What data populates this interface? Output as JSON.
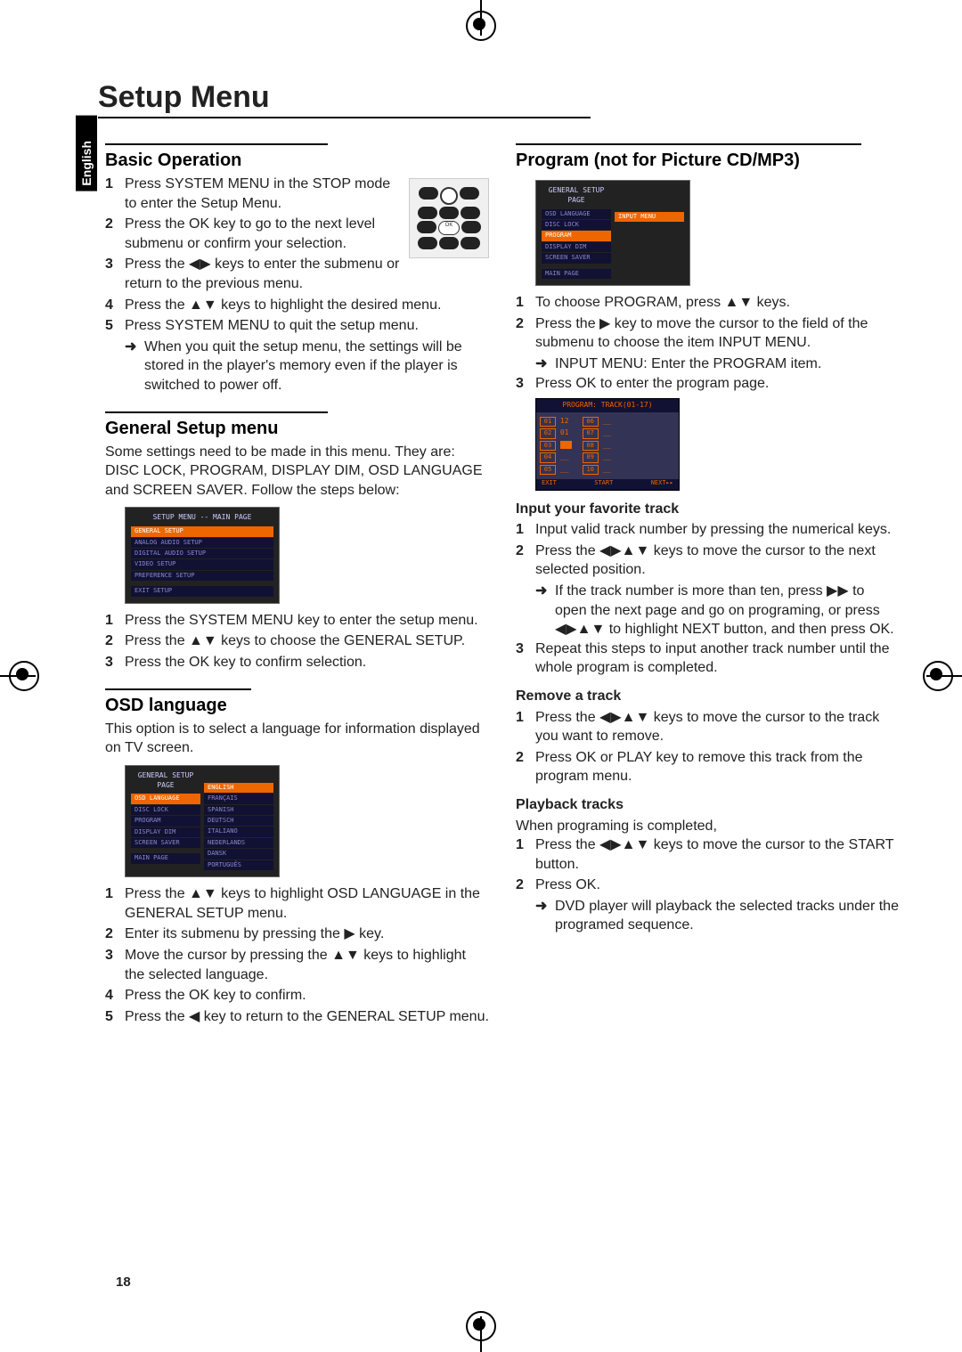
{
  "language_tab": "English",
  "page_title": "Setup Menu",
  "page_number": "18",
  "left": {
    "basic_operation": {
      "heading": "Basic Operation",
      "steps": [
        "Press SYSTEM MENU in the STOP mode to enter the Setup Menu.",
        "Press the OK key to go to the next level submenu or confirm your selection.",
        "Press the ◀▶ keys to enter the submenu or return to the previous menu.",
        "Press the ▲▼ keys to highlight the desired menu.",
        "Press SYSTEM MENU to quit the setup menu."
      ],
      "note": "When you quit the setup menu, the settings will be stored in the player's memory even if the player is switched to power off."
    },
    "general_setup": {
      "heading": "General Setup menu",
      "intro": "Some settings need to be made in this menu. They are: DISC LOCK, PROGRAM, DISPLAY DIM, OSD LANGUAGE and SCREEN SAVER. Follow the steps below:",
      "shot_title": "SETUP MENU -- MAIN PAGE",
      "shot_items": [
        "GENERAL SETUP",
        "ANALOG AUDIO SETUP",
        "DIGITAL AUDIO SETUP",
        "VIDEO SETUP",
        "PREFERENCE SETUP",
        "EXIT SETUP"
      ],
      "steps": [
        "Press the SYSTEM MENU key to enter the setup menu.",
        "Press the ▲▼ keys to choose the GENERAL SETUP.",
        "Press the OK key to confirm selection."
      ]
    },
    "osd_language": {
      "heading": "OSD language",
      "intro": "This option is to select a language for information displayed on TV screen.",
      "shot_title": "GENERAL SETUP PAGE",
      "shot_left": [
        "OSD LANGUAGE",
        "DISC LOCK",
        "PROGRAM",
        "DISPLAY DIM",
        "SCREEN SAVER",
        "MAIN PAGE"
      ],
      "shot_right": [
        "ENGLISH",
        "FRANÇAIS",
        "SPANISH",
        "DEUTSCH",
        "ITALIANO",
        "NEDERLANDS",
        "DANSK",
        "PORTUGUÊS"
      ],
      "steps": [
        "Press the ▲▼ keys to highlight OSD LANGUAGE in the GENERAL SETUP menu.",
        "Enter its submenu by pressing the ▶ key.",
        "Move the cursor by pressing the ▲▼ keys to highlight the selected language.",
        "Press the OK key to confirm.",
        "Press the ◀ key to return to the GENERAL SETUP menu."
      ]
    }
  },
  "right": {
    "program": {
      "heading": "Program (not for Picture CD/MP3)",
      "shot_title": "GENERAL SETUP PAGE",
      "shot_left": [
        "OSD LANGUAGE",
        "DISC LOCK",
        "PROGRAM",
        "DISPLAY DIM",
        "SCREEN SAVER",
        "MAIN PAGE"
      ],
      "shot_right_hl": "INPUT MENU",
      "steps": [
        "To choose PROGRAM, press ▲▼ keys.",
        "Press the ▶ key to move the cursor to the field of the submenu to choose the item INPUT MENU.",
        "Press OK to enter the program page."
      ],
      "step2_note": "INPUT MENU: Enter the PROGRAM item.",
      "prog_shot_hdr": "PROGRAM: TRACK(01-17)",
      "prog_left_idx": [
        "01",
        "02",
        "03",
        "04",
        "05"
      ],
      "prog_left_val": [
        "12",
        "01",
        "",
        "",
        ""
      ],
      "prog_right_idx": [
        "06",
        "07",
        "08",
        "09",
        "10"
      ],
      "prog_ftr": [
        "EXIT",
        "START",
        "NEXT▸▸"
      ]
    },
    "input_track": {
      "heading": "Input your favorite track",
      "steps": [
        "Input valid track number by pressing the numerical keys.",
        "Press the ◀▶▲▼ keys to move the cursor to the next selected position.",
        "Repeat this steps to input another track number until the whole program is completed."
      ],
      "step2_note": "If the track number is more than ten, press ▶▶ to open the next page and go on programing, or press ◀▶▲▼ to highlight NEXT button, and then press OK."
    },
    "remove_track": {
      "heading": "Remove a track",
      "steps": [
        "Press the ◀▶▲▼ keys to move the cursor to the track you want to remove.",
        "Press OK or PLAY key to remove this track from the program menu."
      ]
    },
    "playback": {
      "heading": "Playback tracks",
      "intro": "When programing is completed,",
      "steps": [
        "Press the ◀▶▲▼ keys to move the cursor to the START button.",
        "Press OK."
      ],
      "note": "DVD player will playback the selected tracks under the programed sequence."
    }
  }
}
